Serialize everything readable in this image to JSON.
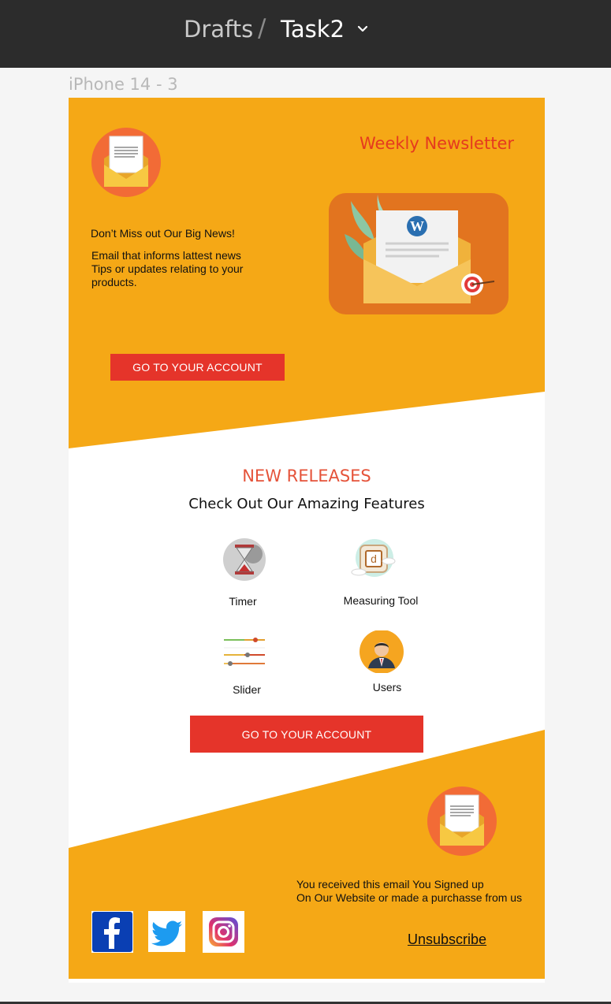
{
  "breadcrumb": {
    "parent": "Drafts",
    "separator": "/",
    "current": "Task2"
  },
  "frame": {
    "label": "iPhone 14 - 3"
  },
  "header": {
    "title": "Weekly Newsletter",
    "tagline": "Don’t Miss out Our Big News!",
    "description": "Email that informs lattest news\nTips or updates relating to your\nproducts.",
    "cta_label": "GO TO YOUR ACCOUNT"
  },
  "releases": {
    "title": "NEW RELEASES",
    "subtitle": "Check Out Our Amazing Features",
    "features": [
      {
        "label": "Timer",
        "icon": "hourglass-icon"
      },
      {
        "label": "Measuring Tool",
        "icon": "measuring-tool-icon"
      },
      {
        "label": "Slider",
        "icon": "slider-icon"
      },
      {
        "label": "Users",
        "icon": "user-icon"
      }
    ],
    "cta_label": "GO TO YOUR ACCOUNT"
  },
  "footer": {
    "note": "You received this email You Signed up\nOn Our Website or made a purchasse from us",
    "unsubscribe": "Unsubscribe",
    "social": [
      "facebook-icon",
      "twitter-icon",
      "instagram-icon"
    ]
  },
  "colors": {
    "accent_orange": "#f5a816",
    "button_red": "#e5342a",
    "title_red": "#e53a1f",
    "topbar": "#2c2c2c"
  }
}
